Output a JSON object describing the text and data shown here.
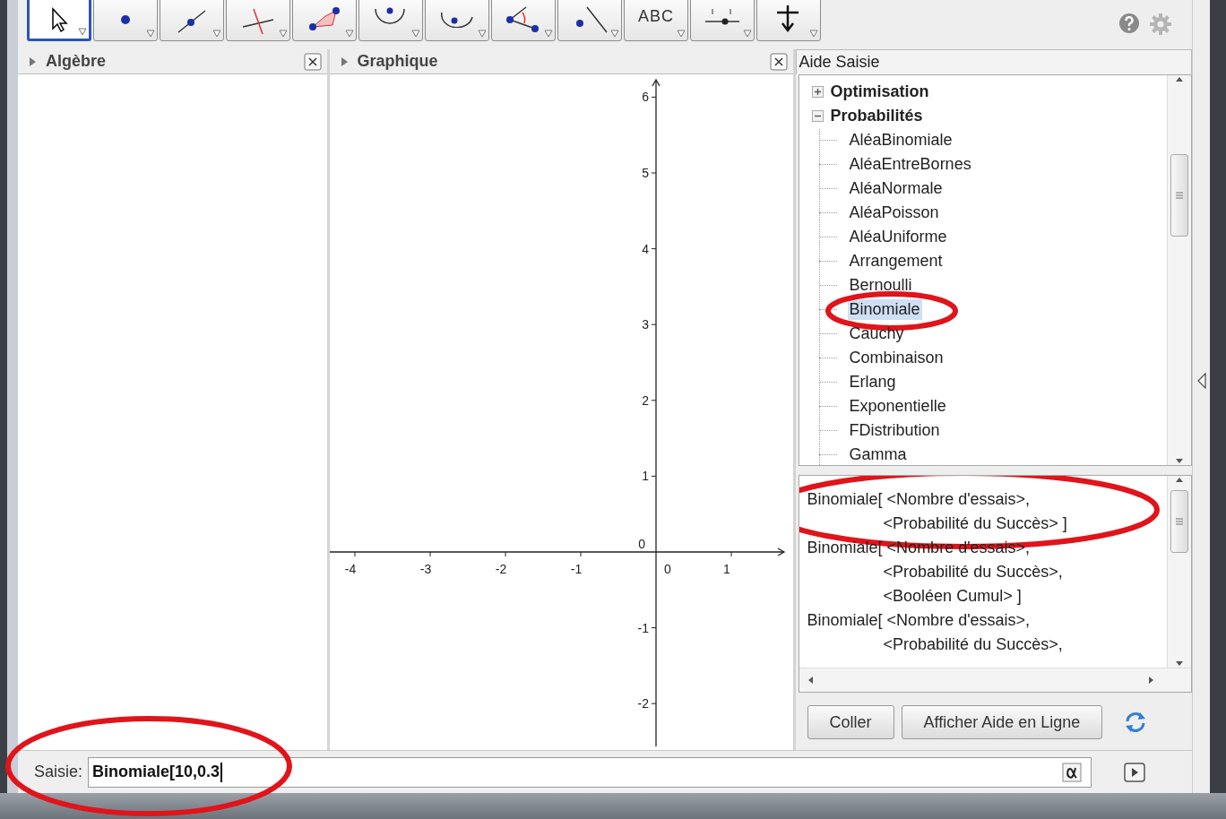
{
  "toolbar": {
    "tools": [
      {
        "kind": "move",
        "selected": true
      },
      {
        "kind": "point",
        "selected": false
      },
      {
        "kind": "line",
        "selected": false
      },
      {
        "kind": "perpendicular",
        "selected": false
      },
      {
        "kind": "polygon",
        "selected": false
      },
      {
        "kind": "circle",
        "selected": false
      },
      {
        "kind": "ellipse",
        "selected": false
      },
      {
        "kind": "angle",
        "selected": false
      },
      {
        "kind": "reflect",
        "selected": false
      },
      {
        "kind": "text",
        "text": "ABC",
        "selected": false
      },
      {
        "kind": "slider",
        "selected": false
      },
      {
        "kind": "move_view",
        "selected": false
      }
    ]
  },
  "algebra": {
    "title": "Algèbre"
  },
  "graphics": {
    "title": "Graphique",
    "x_ticks": [
      "-4",
      "-3",
      "-2",
      "-1",
      "0",
      "1"
    ],
    "y_ticks": [
      "6",
      "5",
      "4",
      "3",
      "2",
      "1",
      "0",
      "-1",
      "-2"
    ]
  },
  "input_help": {
    "title": "Aide Saisie",
    "tree": [
      {
        "label": "Optimisation",
        "expanded": false
      },
      {
        "label": "Probabilités",
        "expanded": true,
        "children": [
          {
            "label": "AléaBinomiale",
            "selected": false,
            "circled": false
          },
          {
            "label": "AléaEntreBornes",
            "selected": false,
            "circled": false
          },
          {
            "label": "AléaNormale",
            "selected": false,
            "circled": false
          },
          {
            "label": "AléaPoisson",
            "selected": false,
            "circled": false
          },
          {
            "label": "AléaUniforme",
            "selected": false,
            "circled": false
          },
          {
            "label": "Arrangement",
            "selected": false,
            "circled": false
          },
          {
            "label": "Bernoulli",
            "selected": false,
            "circled": false
          },
          {
            "label": "Binomiale",
            "selected": true,
            "circled": true
          },
          {
            "label": "Cauchy",
            "selected": false,
            "circled": false
          },
          {
            "label": "Combinaison",
            "selected": false,
            "circled": false
          },
          {
            "label": "Erlang",
            "selected": false,
            "circled": false
          },
          {
            "label": "Exponentielle",
            "selected": false,
            "circled": false
          },
          {
            "label": "FDistribution",
            "selected": false,
            "circled": false
          },
          {
            "label": "Gamma",
            "selected": false,
            "circled": false
          }
        ]
      }
    ],
    "syntax": [
      {
        "lines": [
          "Binomiale[ <Nombre d'essais>,",
          "<Probabilité du Succès> ]"
        ],
        "circled": true
      },
      {
        "lines": [
          "Binomiale[ <Nombre d'essais>,",
          "<Probabilité du Succès>,",
          "<Booléen Cumul> ]"
        ],
        "circled": false
      },
      {
        "lines": [
          "Binomiale[ <Nombre d'essais>,",
          "<Probabilité du Succès>,"
        ],
        "circled": false
      }
    ],
    "buttons": [
      "Coller",
      "Afficher Aide en Ligne"
    ]
  },
  "input_bar": {
    "label": "Saisie:",
    "value": "Binomiale[10,0.3",
    "circled": true
  }
}
